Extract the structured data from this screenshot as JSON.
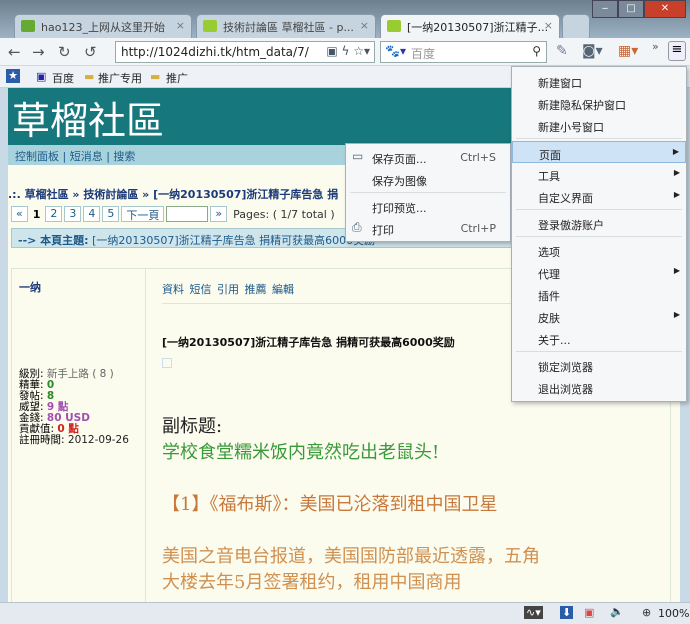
{
  "tabs": [
    {
      "title": "hao123_上网从这里开始"
    },
    {
      "title": "技術討論區 草榴社區 - p..."
    },
    {
      "title": "[一纳20130507]浙江精子..."
    }
  ],
  "toolbar": {
    "url": "http://1024dizhi.tk/htm_data/7/",
    "search_placeholder": "百度",
    "more": "»"
  },
  "bookmarks": [
    "百度",
    "推广专用",
    "推广"
  ],
  "site": {
    "title": "草榴社區",
    "nav": [
      "控制面板",
      "短消息",
      "搜索"
    ],
    "breadcrumb": ".:. 草榴社區 » 技術討論區 » [一纳20130507]浙江精子库告急 捐",
    "pager": {
      "first": "«",
      "pages": [
        "1",
        "2",
        "3",
        "4",
        "5"
      ],
      "next": "下一頁",
      "last": "»",
      "info": "Pages: ( 1/7 total )"
    },
    "topic_label": "--> 本頁主題:",
    "topic": "[一纳20130507]浙江精子库告急 捐精可获最高6000奖励"
  },
  "post": {
    "author": "一纳",
    "actions": [
      "資料",
      "短信",
      "引用",
      "推薦",
      "編輯"
    ],
    "title": "[一纳20130507]浙江精子库告急 捐精可获最高6000奖励",
    "stats": [
      {
        "label": "級別:",
        "value": "新手上路 ( 8 )",
        "color": "#666666"
      },
      {
        "label": "精華:",
        "value": "0",
        "color": "#2a8a2a"
      },
      {
        "label": "發帖:",
        "value": "8",
        "color": "#2a8a2a"
      },
      {
        "label": "威望:",
        "value": "9 點",
        "color": "#a050b0"
      },
      {
        "label": "金錢:",
        "value": "80 USD",
        "color": "#a050b0"
      },
      {
        "label": "貢獻值:",
        "value": "0 點",
        "color": "#d02020"
      },
      {
        "label": "註冊時間:",
        "value": "2012-09-26",
        "color": "#222222"
      }
    ],
    "subtitle_label": "副标题:",
    "subtitle": "学校食堂糯米饭内竟然吃出老鼠头!",
    "heading": "【1】《福布斯》：美国已沦落到租中国卫星",
    "body1": "美国之音电台报道，美国国防部最近透露，五角",
    "body2": "大楼去年5月签署租约，租用中国商用"
  },
  "main_menu": [
    {
      "label": "新建窗口"
    },
    {
      "label": "新建隐私保护窗口"
    },
    {
      "label": "新建小号窗口"
    },
    {
      "sep": true
    },
    {
      "label": "页面",
      "sub": true,
      "hl": true
    },
    {
      "label": "工具",
      "sub": true
    },
    {
      "label": "自定义界面",
      "sub": true
    },
    {
      "sep": true
    },
    {
      "label": "登录傲游账户"
    },
    {
      "sep": true
    },
    {
      "label": "选项"
    },
    {
      "label": "代理",
      "sub": true
    },
    {
      "label": "插件"
    },
    {
      "label": "皮肤",
      "sub": true
    },
    {
      "label": "关于..."
    },
    {
      "sep": true
    },
    {
      "label": "锁定浏览器"
    },
    {
      "label": "退出浏览器"
    }
  ],
  "page_menu": [
    {
      "label": "保存页面...",
      "shortcut": "Ctrl+S",
      "icon": "save-icon"
    },
    {
      "label": "保存为图像"
    },
    {
      "sep": true
    },
    {
      "label": "打印预览..."
    },
    {
      "label": "打印",
      "shortcut": "Ctrl+P",
      "icon": "print-icon"
    }
  ],
  "status": {
    "zoom": "100%"
  }
}
